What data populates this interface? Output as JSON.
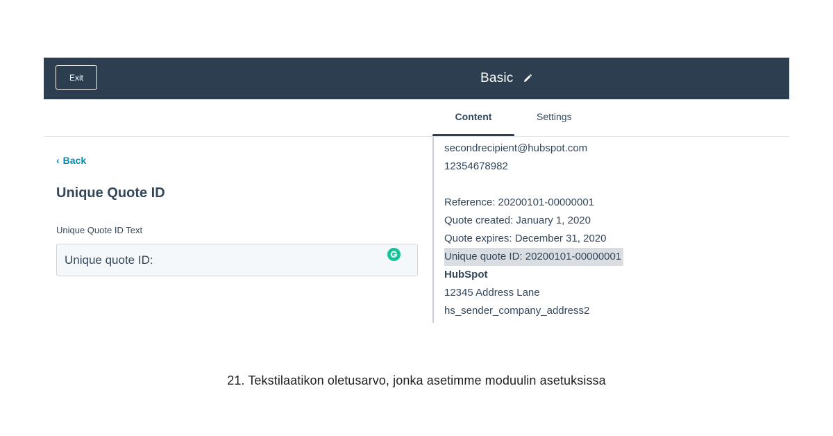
{
  "header": {
    "exit_label": "Exit",
    "title": "Basic",
    "edit_icon": "pencil-icon"
  },
  "tabs": [
    {
      "label": "Content",
      "active": true
    },
    {
      "label": "Settings",
      "active": false
    }
  ],
  "left_panel": {
    "back_label": "Back",
    "section_title": "Unique Quote ID",
    "field_label": "Unique Quote ID Text",
    "field_value": "Unique quote ID:",
    "assistant_icon": "grammarly-icon"
  },
  "preview": {
    "lines": [
      "secondrecipient@hubspot.com",
      "12354678982",
      "Reference: 20200101-00000001",
      "Quote created: January 1, 2020",
      "Quote expires: December 31, 2020",
      "Unique quote ID: 20200101-00000001",
      "HubSpot",
      "12345 Address Lane",
      "hs_sender_company_address2"
    ]
  },
  "caption": "21. Tekstilaatikon oletusarvo, jonka asetimme moduulin asetuksissa",
  "colors": {
    "topbar": "#2d3e50",
    "link": "#0091ae",
    "text": "#33475b",
    "highlight": "#dadde1",
    "grammarly": "#15c39a"
  }
}
